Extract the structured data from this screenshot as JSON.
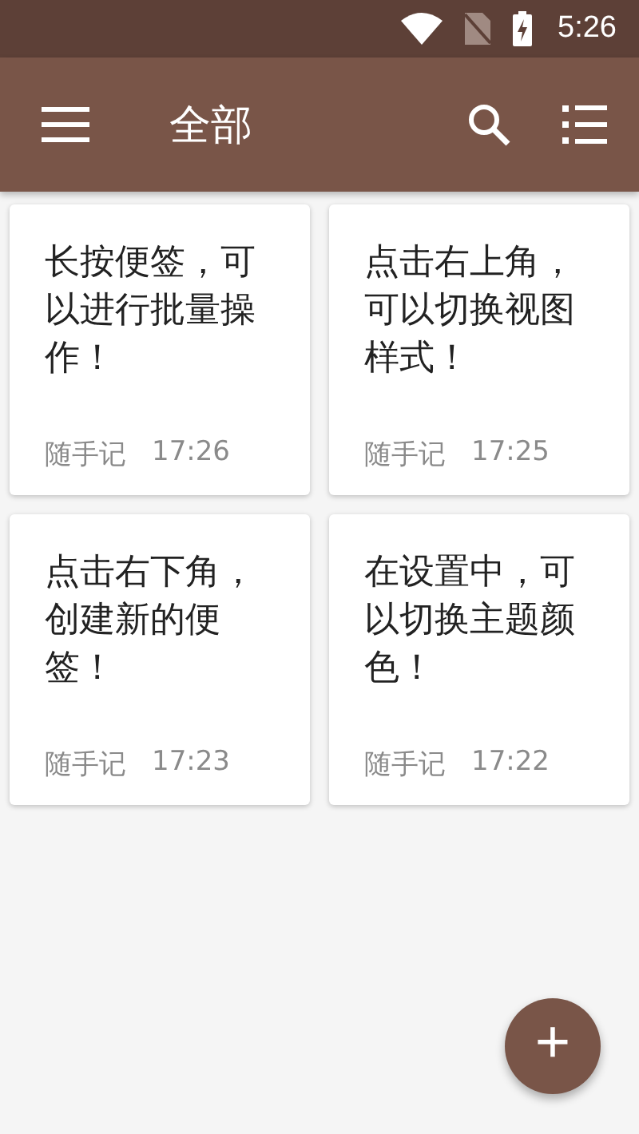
{
  "status_bar": {
    "time": "5:26"
  },
  "toolbar": {
    "title": "全部"
  },
  "notes": [
    {
      "text": "长按便签，可以进行批量操作！",
      "source": "随手记",
      "time": "17:26"
    },
    {
      "text": "点击右上角，可以切换视图样式！",
      "source": "随手记",
      "time": "17:25"
    },
    {
      "text": "点击右下角，创建新的便签！",
      "source": "随手记",
      "time": "17:23"
    },
    {
      "text": "在设置中，可以切换主题颜色！",
      "source": "随手记",
      "time": "17:22"
    }
  ],
  "fab": {
    "label": "+"
  }
}
